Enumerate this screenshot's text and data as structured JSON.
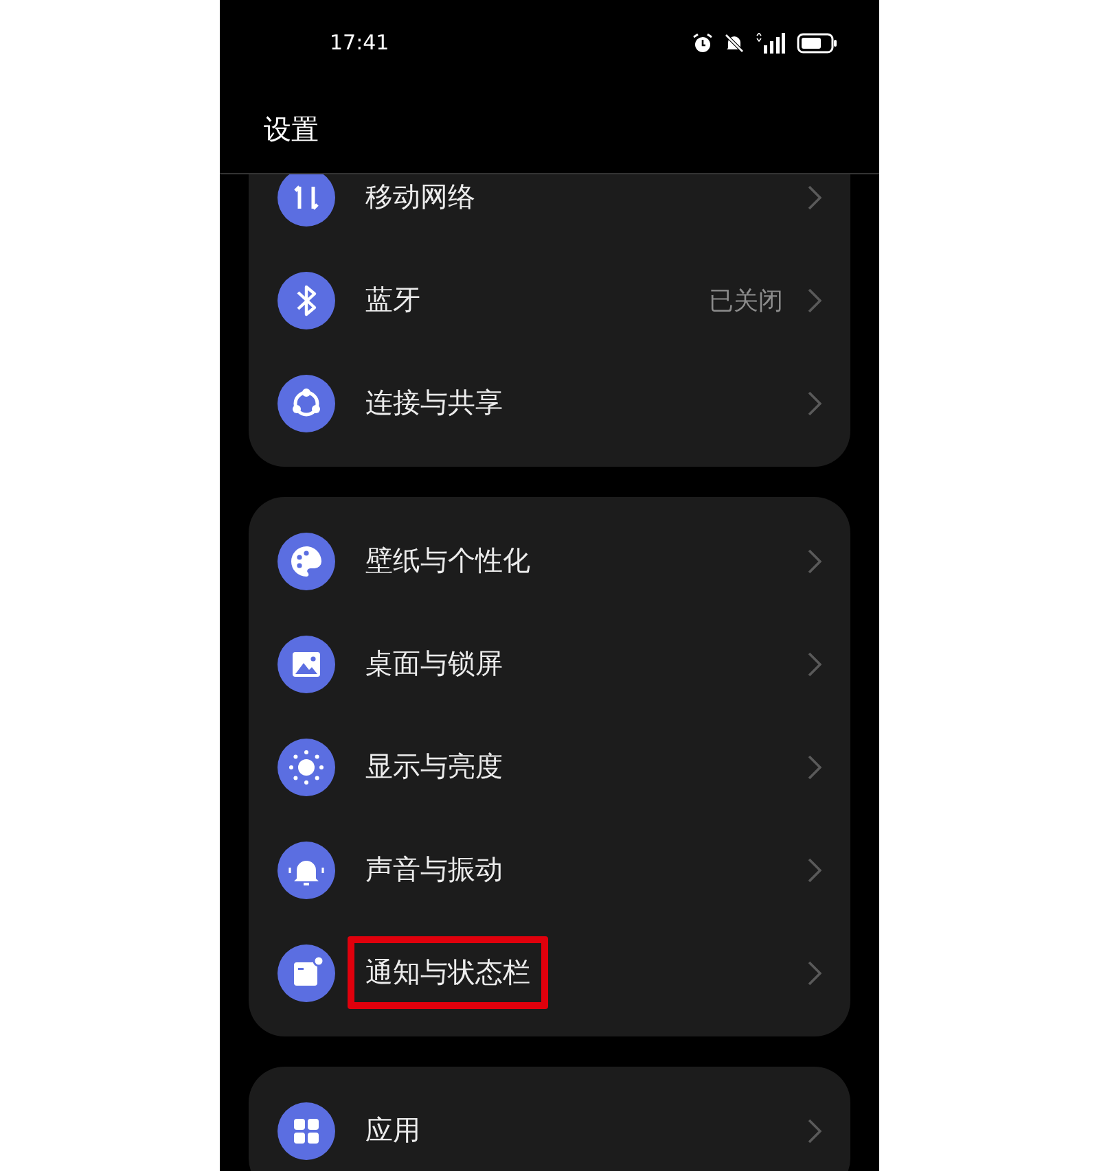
{
  "status_bar": {
    "time": "17:41"
  },
  "header": {
    "title": "设置"
  },
  "groups": [
    {
      "items": [
        {
          "kind": "mobile-data",
          "label": "移动网络",
          "value": "",
          "highlighted": false
        },
        {
          "kind": "bluetooth",
          "label": "蓝牙",
          "value": "已关闭",
          "highlighted": false
        },
        {
          "kind": "share",
          "label": "连接与共享",
          "value": "",
          "highlighted": false
        }
      ]
    },
    {
      "items": [
        {
          "kind": "palette",
          "label": "壁纸与个性化",
          "value": "",
          "highlighted": false
        },
        {
          "kind": "image",
          "label": "桌面与锁屏",
          "value": "",
          "highlighted": false
        },
        {
          "kind": "brightness",
          "label": "显示与亮度",
          "value": "",
          "highlighted": false
        },
        {
          "kind": "bell",
          "label": "声音与振动",
          "value": "",
          "highlighted": false
        },
        {
          "kind": "notification",
          "label": "通知与状态栏",
          "value": "",
          "highlighted": true
        }
      ]
    },
    {
      "items": [
        {
          "kind": "apps",
          "label": "应用",
          "value": "",
          "highlighted": false
        }
      ]
    }
  ]
}
